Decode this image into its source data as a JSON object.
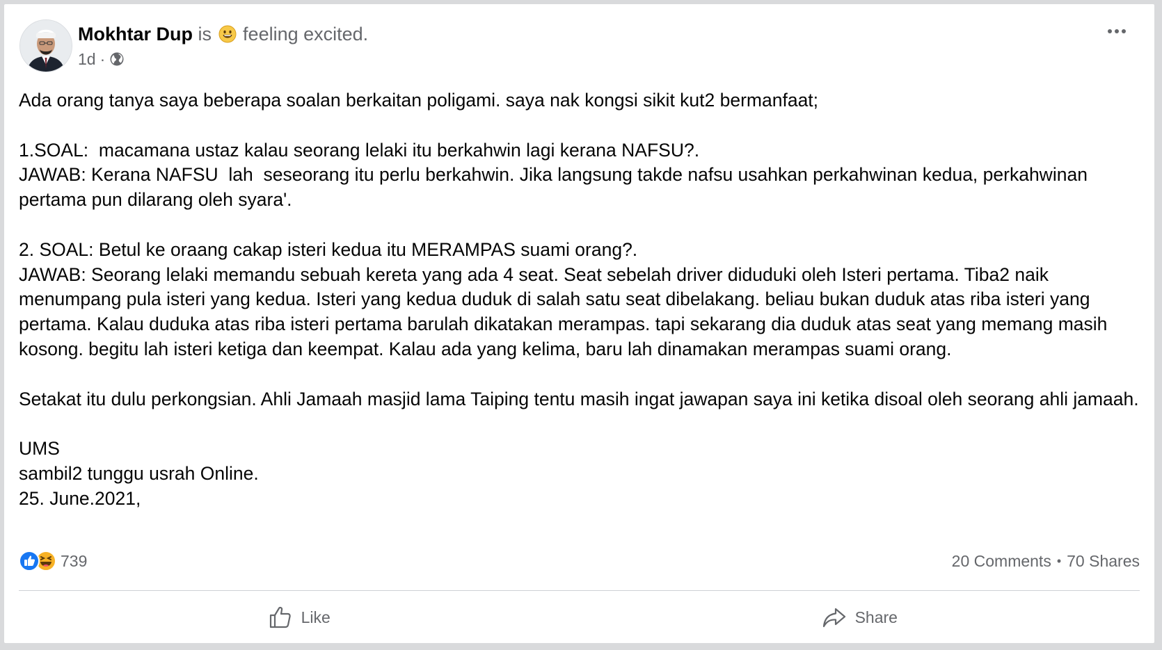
{
  "post": {
    "author": "Mokhtar Dup",
    "feeling_prefix": "is",
    "feeling_emoji": "smiling-face-emoji",
    "feeling_text": "feeling excited.",
    "timestamp": "1d",
    "meta_separator": "·",
    "audience_icon": "globe-icon",
    "more_icon": "more-options-icon",
    "body": [
      "Ada orang tanya saya beberapa soalan berkaitan poligami. saya nak kongsi sikit kut2 bermanfaat;",
      "1.SOAL:  macamana ustaz kalau seorang lelaki itu berkahwin lagi kerana NAFSU?.",
      "JAWAB: Kerana NAFSU  lah  seseorang itu perlu berkahwin. Jika langsung takde nafsu usahkan perkahwinan kedua, perkahwinan pertama pun dilarang oleh syara'.",
      "2. SOAL: Betul ke oraang cakap isteri kedua itu MERAMPAS suami orang?.",
      "JAWAB: Seorang lelaki memandu sebuah kereta yang ada 4 seat. Seat sebelah driver diduduki oleh Isteri pertama. Tiba2 naik menumpang pula isteri yang kedua. Isteri yang kedua duduk di salah satu seat dibelakang. beliau bukan duduk atas riba isteri yang pertama. Kalau duduka atas riba isteri pertama barulah dikatakan merampas. tapi sekarang dia duduk atas seat yang memang masih kosong. begitu lah isteri ketiga dan keempat. Kalau ada yang kelima, baru lah dinamakan merampas suami orang.",
      "Setakat itu dulu perkongsian. Ahli Jamaah masjid lama Taiping tentu masih ingat jawapan saya ini ketika disoal oleh seorang ahli jamaah.",
      "UMS",
      "sambil2 tunggu usrah Online.",
      "25. June.2021,"
    ]
  },
  "stats": {
    "reaction_icons": [
      "like-reaction-icon",
      "haha-reaction-icon"
    ],
    "reaction_count": "739",
    "comments": "20 Comments",
    "separator": "•",
    "shares": "70 Shares"
  },
  "actions": {
    "like_label": "Like",
    "like_icon": "thumbs-up-icon",
    "share_label": "Share",
    "share_icon": "share-arrow-icon"
  },
  "colors": {
    "text_primary": "#050505",
    "text_secondary": "#65676b",
    "like_blue": "#1877f2",
    "haha_yellow": "#f7b125",
    "frame_gray": "#d9dadc"
  }
}
